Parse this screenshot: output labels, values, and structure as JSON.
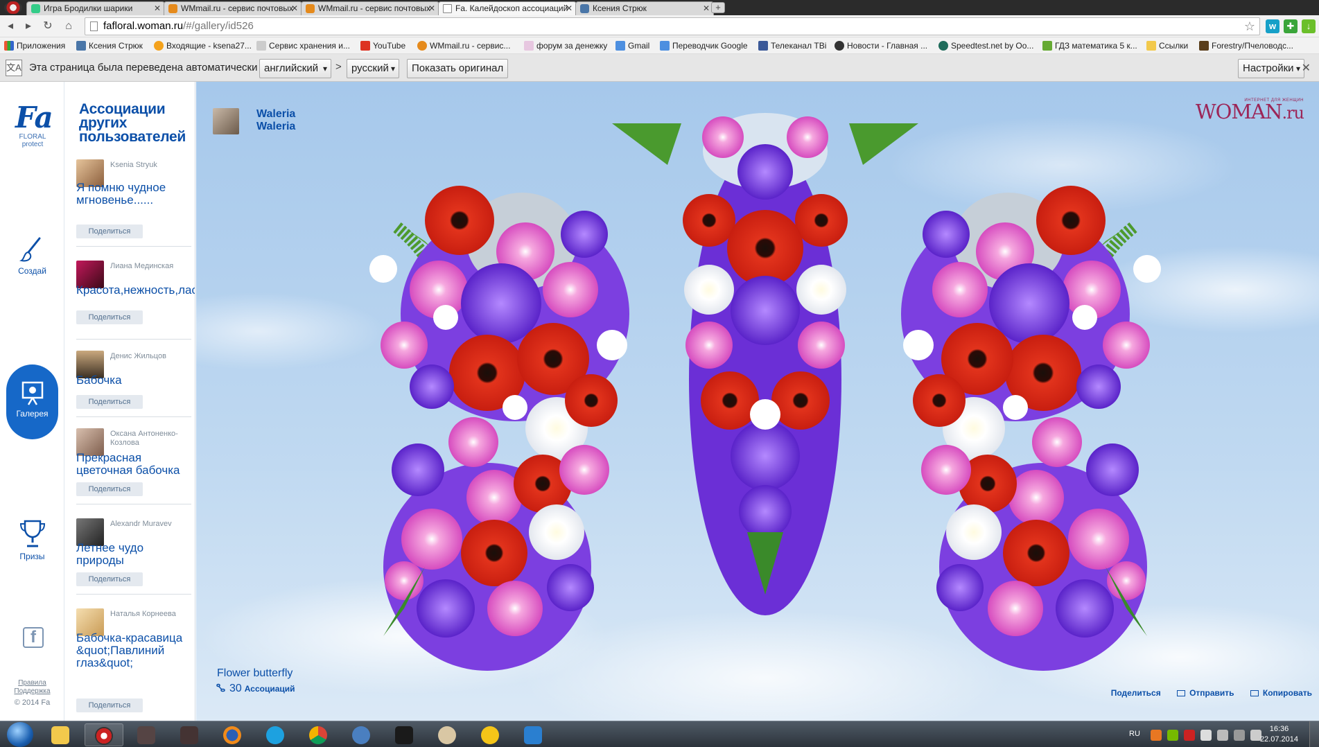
{
  "browser": {
    "tabs": [
      {
        "title": "Игра Бродилки шарики",
        "favicon": "game-icon"
      },
      {
        "title": "WMmail.ru - сервис почтовых",
        "favicon": "wmmail-icon"
      },
      {
        "title": "WMmail.ru - сервис почтовых",
        "favicon": "wmmail-icon"
      },
      {
        "title": "Fa. Калейдоскоп ассоциаций",
        "favicon": "page-icon"
      },
      {
        "title": "Ксения Стрюк",
        "favicon": "vk-icon"
      }
    ],
    "url_host": "fafloral.woman.ru",
    "url_path": "/#/gallery/id526",
    "bookmarks": [
      "Приложения",
      "Ксения Стрюк",
      "Входящие - ksena27...",
      "Сервис хранения и...",
      "YouTube",
      "WMmail.ru - сервис...",
      "форум за денежку",
      "Gmail",
      "Переводчик Google",
      "Телеканал ТВі",
      "Новости - Главная ...",
      "Speedtest.net by Oo...",
      "ГДЗ математика 5 к...",
      "Ссылки",
      "Forestry/Пчеловодс..."
    ]
  },
  "translate": {
    "message": "Эта страница была переведена автоматически",
    "from_lang": "английский",
    "separator": ">",
    "to_lang": "русский",
    "show_original": "Показать оригинал",
    "settings": "Настройки"
  },
  "sidebar": {
    "logo_main": "Fa",
    "logo_sub1": "FLORAL",
    "logo_sub2": "protect",
    "nav": [
      {
        "label": "Создай",
        "icon": "brush-icon",
        "active": false
      },
      {
        "label": "Галерея",
        "icon": "gallery-icon",
        "active": true
      },
      {
        "label": "Призы",
        "icon": "trophy-icon",
        "active": false
      }
    ],
    "social_icon": "facebook-icon",
    "rules": "Правила",
    "support": "Поддержка",
    "copyright": "© 2014 Fa"
  },
  "feed": {
    "title": "Ассоциации других пользователей",
    "share_label": "Поделиться",
    "items": [
      {
        "user": "Ksenia Stryuk",
        "text": "Я помню чудное мгновенье......",
        "avatar_color": "#c9a27a"
      },
      {
        "user": "Лиана Мединская",
        "text": "Красота,нежность,ласка!",
        "avatar_color": "#9b1b3a"
      },
      {
        "user": "Денис Жильцов",
        "text": "Бабочка",
        "avatar_color": "#6a5a48"
      },
      {
        "user": "Оксана Антоненко-Козлова",
        "text": "Прекрасная цветочная бабочка",
        "avatar_color": "#b89a86"
      },
      {
        "user": "Alexandr Muravev",
        "text": "Летнее чудо природы",
        "avatar_color": "#4d4d4d"
      },
      {
        "user": "Наталья Корнеева",
        "text": "Бабочка-красавица &quot;Павлиний глаз&quot;",
        "avatar_color": "#e9c98f"
      }
    ]
  },
  "main": {
    "author_first": "Waleria",
    "author_last": "Waleria",
    "brand_logo": "WOMAN",
    "brand_suffix": ".ru",
    "brand_tagline": "ИНТЕРНЕТ ДЛЯ ЖЕНЩИН",
    "work_title": "Flower butterfly",
    "assoc_count": "30",
    "assoc_label": "Ассоциаций",
    "actions": {
      "share": "Поделиться",
      "send": "Отправить",
      "copy": "Копировать"
    }
  },
  "taskbar": {
    "lang": "RU",
    "time": "16:36",
    "date": "22.07.2014"
  }
}
